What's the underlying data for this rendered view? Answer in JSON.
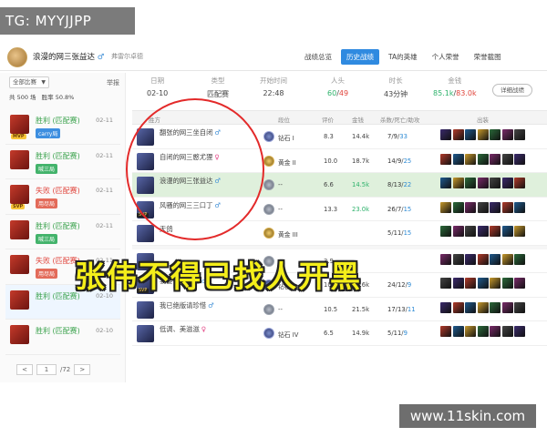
{
  "watermark_tl": "TG: MYYJJPP",
  "watermark_br": "www.11skin.com",
  "overlay_caption": "张伟不得已找人开黑",
  "topbar": {
    "player_name": "浪漫的网三张益达",
    "gender": "♂",
    "server": "弗雷尔卓德",
    "tabs": [
      "战绩总览",
      "历史战绩",
      "TA的英雄",
      "个人荣誉",
      "荣誉截图"
    ],
    "active_tab": 1
  },
  "left": {
    "filter_label": "全部比赛",
    "report_label": "举报",
    "stats_total": "共 500 场",
    "stats_winrate": "胜率 50.8%",
    "matches": [
      {
        "result": "胜利 (匹配赛)",
        "type": "win",
        "date": "02-11",
        "badge": "MVP",
        "tag": "carry局",
        "tag_color": "blue"
      },
      {
        "result": "胜利 (匹配赛)",
        "type": "win",
        "date": "02-11",
        "badge": "",
        "tag": "喊三局",
        "tag_color": "green"
      },
      {
        "result": "失败 (匹配赛)",
        "type": "loss",
        "date": "02-11",
        "badge": "SVP",
        "tag": "用尽局",
        "tag_color": "red"
      },
      {
        "result": "胜利 (匹配赛)",
        "type": "win",
        "date": "02-11",
        "badge": "",
        "tag": "喊三局",
        "tag_color": "green"
      },
      {
        "result": "失败 (匹配赛)",
        "type": "loss",
        "date": "02-11",
        "badge": "",
        "tag": "用尽局",
        "tag_color": "red"
      },
      {
        "result": "胜利 (匹配赛)",
        "type": "win",
        "date": "02-10",
        "badge": "",
        "tag": "",
        "tag_color": "blue"
      },
      {
        "result": "胜利 (匹配赛)",
        "type": "win",
        "date": "02-10",
        "badge": "",
        "tag": "",
        "tag_color": "blue"
      }
    ],
    "pager": {
      "prev": "<",
      "page": "1",
      "total": "/72",
      "next": ">"
    }
  },
  "summary": {
    "labels": [
      "日期",
      "类型",
      "开始时间",
      "人头",
      "时长",
      "金钱"
    ],
    "date": "02-10",
    "type": "匹配赛",
    "start": "22:48",
    "kills": "60",
    "deaths": "49",
    "duration": "43分钟",
    "gold_a": "85.1k",
    "gold_b": "83.0k",
    "detail_button": "详细战绩"
  },
  "table": {
    "headers": [
      "胜方",
      "段位",
      "评价",
      "金钱",
      "杀数/死亡/助攻",
      "出装"
    ],
    "rows": [
      {
        "name": "翻张的网三坐自闭",
        "gender": "♂",
        "sub": "",
        "badge": "",
        "rank_icon": "blue",
        "rank": "钻石 I",
        "score": "8.3",
        "gold": "14.4k",
        "k": "7",
        "d": "9",
        "a": "33",
        "me": false
      },
      {
        "name": "自闭的网三憨尤狸",
        "gender": "♀",
        "sub": "",
        "badge": "",
        "rank_icon": "gold",
        "rank": "黄金 II",
        "score": "10.0",
        "gold": "18.7k",
        "k": "14",
        "d": "9",
        "a": "25",
        "me": false
      },
      {
        "name": "浪漫的网三张益达",
        "gender": "♂",
        "sub": "",
        "badge": "",
        "rank_icon": "plain",
        "rank": "--",
        "score": "6.6",
        "gold": "14.5k",
        "k": "8",
        "d": "13",
        "a": "22",
        "me": true
      },
      {
        "name": "风骚的网三三口丁",
        "gender": "♂",
        "sub": "",
        "badge": "SVP",
        "rank_icon": "plain",
        "rank": "--",
        "score": "13.3",
        "gold": "23.0k",
        "k": "26",
        "d": "7",
        "a": "15",
        "me": false
      },
      {
        "name": "天鸽",
        "gender": "",
        "sub": "",
        "badge": "",
        "rank_icon": "gold",
        "rank": "黄金 III",
        "score": "",
        "gold": "",
        "k": "5",
        "d": "11",
        "a": "15",
        "me": false
      },
      {
        "name": "",
        "gender": "",
        "sub": "",
        "badge": "",
        "rank_icon": "plain",
        "rank": "",
        "score": "3.9",
        "gold": "",
        "k": "",
        "d": "",
        "a": "",
        "me": false
      },
      {
        "name": "我要去银河啦",
        "gender": "♂",
        "sub": "",
        "badge": "SVP",
        "rank_icon": "blue",
        "rank": "钻石 I",
        "score": "10.5",
        "gold": "20.6k",
        "k": "24",
        "d": "12",
        "a": "9",
        "me": false
      },
      {
        "name": "我已绝版请珍惜",
        "gender": "♂",
        "sub": "",
        "badge": "",
        "rank_icon": "plain",
        "rank": "--",
        "score": "10.5",
        "gold": "21.5k",
        "k": "17",
        "d": "13",
        "a": "11",
        "me": false
      },
      {
        "name": "低调、美滋滋",
        "gender": "♀",
        "sub": "",
        "badge": "",
        "rank_icon": "blue",
        "rank": "钻石 IV",
        "score": "6.5",
        "gold": "14.9k",
        "k": "5",
        "d": "11",
        "a": "9",
        "me": false
      }
    ]
  },
  "colors": {
    "accent": "#2f8ae0",
    "win": "#3aa24c",
    "loss": "#e0433a",
    "caption": "#f4ee1a",
    "circle": "#e32a2a",
    "highlight_row": "#dff0dc"
  }
}
